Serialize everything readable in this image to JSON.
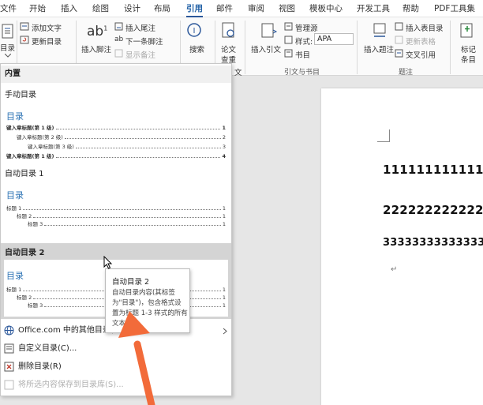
{
  "tabs": [
    {
      "label": "文件"
    },
    {
      "label": "开始"
    },
    {
      "label": "插入"
    },
    {
      "label": "绘图"
    },
    {
      "label": "设计"
    },
    {
      "label": "布局"
    },
    {
      "label": "引用",
      "active": true
    },
    {
      "label": "邮件"
    },
    {
      "label": "审阅"
    },
    {
      "label": "视图"
    },
    {
      "label": "模板中心"
    },
    {
      "label": "开发工具"
    },
    {
      "label": "帮助"
    },
    {
      "label": "PDF工具集"
    }
  ],
  "ribbon": {
    "toc_button": "目录",
    "add_text": "添加文字",
    "update_toc": "更新目录",
    "insert_footnote": "插入脚注",
    "insert_endnote": "插入尾注",
    "next_footnote": "下一条脚注",
    "show_notes": "显示备注",
    "search": "搜索",
    "paper_check_1": "论文",
    "paper_check_2": "查重",
    "insert_citation": "插入引文",
    "manage_sources": "管理源",
    "style_label": "样式:",
    "style_value": "APA",
    "bibliography": "书目",
    "group_citations": "引文与书目",
    "insert_caption": "插入题注",
    "insert_table_of_figures": "插入表目录",
    "update_table": "更新表格",
    "cross_reference": "交叉引用",
    "group_captions": "题注",
    "mark_entry_1": "标记",
    "mark_entry_2": "条目",
    "toc_group_tail": "文"
  },
  "dropdown": {
    "builtin_header": "内置",
    "manual_toc": "手动目录",
    "preview_title": "目录",
    "manual_lines": [
      {
        "label": "键入章标题(第 1 级)",
        "page": "1"
      },
      {
        "label": "键入章标题(第 2 级)",
        "page": "2"
      },
      {
        "label": "键入章标题(第 3 级)",
        "page": "3"
      },
      {
        "label": "键入章标题(第 1 级)",
        "page": "4"
      }
    ],
    "auto1": "自动目录 1",
    "auto2": "自动目录 2",
    "auto_lines": [
      {
        "label": "标题 1",
        "page": "1"
      },
      {
        "label": "标题 2",
        "page": "1"
      },
      {
        "label": "标题 3",
        "page": "1"
      }
    ],
    "more_office": "Office.com 中的其他目录(M)",
    "custom_toc": "自定义目录(C)...",
    "remove_toc": "删除目录(R)",
    "save_selection": "将所选内容保存到目录库(S)..."
  },
  "tooltip": {
    "title": "自动目录 2",
    "body": "自动目录内容(其标签为\"目录\")，包含格式设置为标题 1-3 样式的所有文本"
  },
  "document": {
    "lines": [
      "111111111111111",
      "2222222222222222",
      "3333333333333333"
    ],
    "return_mark": "↵"
  },
  "colors": {
    "accent": "#2b579a",
    "toc_title": "#2e74b5",
    "annotation_arrow": "#f26b3a"
  }
}
